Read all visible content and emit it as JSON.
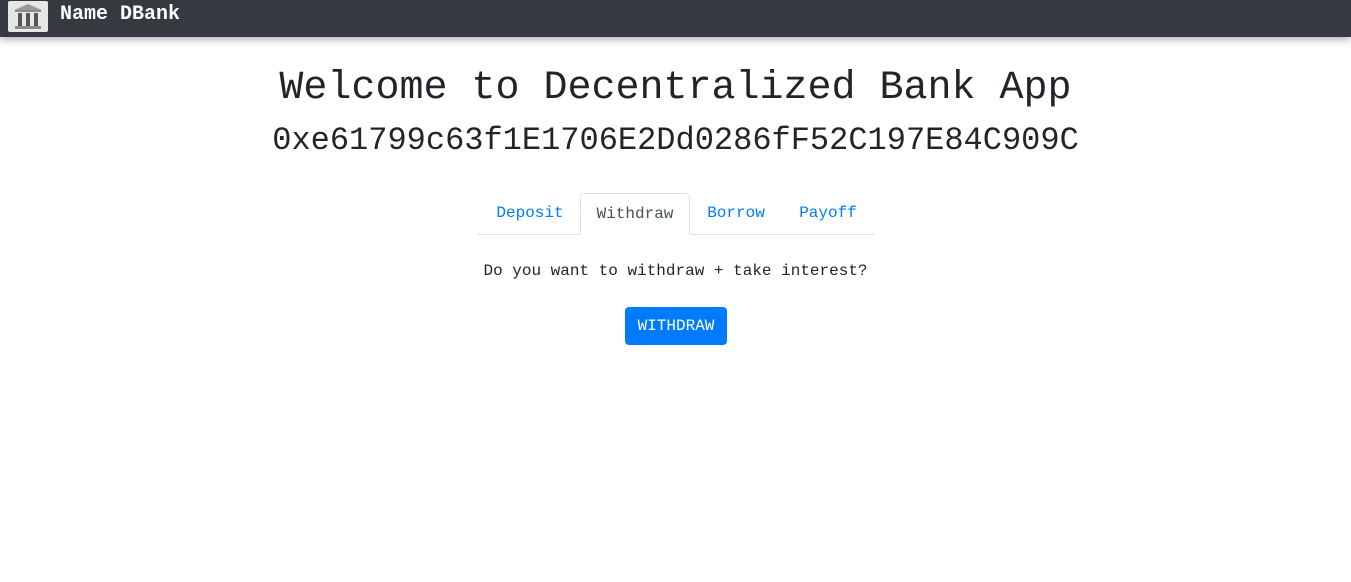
{
  "navbar": {
    "logo_icon": "bank-building-icon",
    "brand_name": "Name DBank"
  },
  "header": {
    "title": "Welcome to Decentralized Bank App",
    "account_address": "0xe61799c63f1E1706E2Dd0286fF52C197E84C909C"
  },
  "tabs": [
    {
      "label": "Deposit",
      "active": false
    },
    {
      "label": "Withdraw",
      "active": true
    },
    {
      "label": "Borrow",
      "active": false
    },
    {
      "label": "Payoff",
      "active": false
    }
  ],
  "withdraw_panel": {
    "prompt": "Do you want to withdraw + take interest?",
    "button_label": "WITHDRAW"
  },
  "colors": {
    "navbar_bg": "#343a40",
    "link": "#007bff",
    "primary_button": "#007bff"
  }
}
